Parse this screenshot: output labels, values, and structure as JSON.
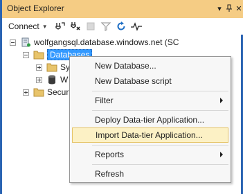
{
  "window": {
    "title": "Object Explorer",
    "buttons": {
      "dropdown_glyph": "▾",
      "pin_glyph": "⊣",
      "close_glyph": "✕"
    }
  },
  "toolbar": {
    "connect_label": "Connect",
    "connect_arrow": "▼",
    "icons": [
      "connect-icon",
      "disconnect-icon",
      "stop-icon",
      "filter-icon",
      "refresh-icon",
      "activity-monitor-icon"
    ]
  },
  "tree": {
    "server_label": "wolfgangsql.database.windows.net (SC",
    "databases_label": "Databases",
    "child1_label": "Sy",
    "child2_label": "W",
    "security_label": "Secur"
  },
  "context_menu": {
    "items": [
      {
        "label": "New Database...",
        "submenu": false
      },
      {
        "label": "New Database script",
        "submenu": false
      },
      {
        "label": "Filter",
        "submenu": true
      },
      {
        "label": "Deploy Data-tier Application...",
        "submenu": false
      },
      {
        "label": "Import Data-tier Application...",
        "submenu": false,
        "highlighted": true
      },
      {
        "label": "Reports",
        "submenu": true
      },
      {
        "label": "Refresh",
        "submenu": false
      }
    ]
  },
  "colors": {
    "titlebar": "#f5cc84",
    "frame": "#2b64b3",
    "selection": "#3399ff",
    "menu_highlight": "#fcf1c5"
  }
}
